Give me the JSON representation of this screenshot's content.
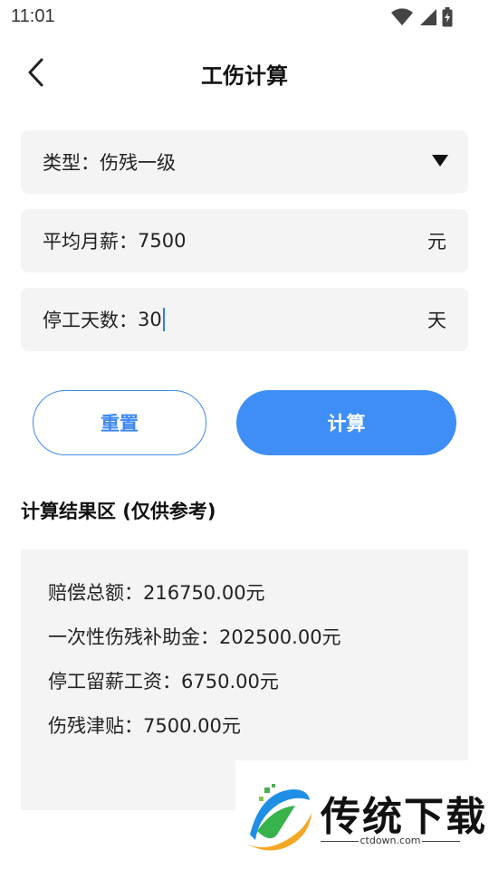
{
  "status": {
    "time": "11:01"
  },
  "header": {
    "title": "工伤计算"
  },
  "form": {
    "type_label": "类型：",
    "type_value": "伤残一级",
    "salary_label": "平均月薪：",
    "salary_value": "7500",
    "salary_unit": "元",
    "days_label": "停工天数：",
    "days_value": "30",
    "days_unit": "天"
  },
  "buttons": {
    "reset": "重置",
    "calculate": "计算"
  },
  "results": {
    "title": "计算结果区 (仅供参考)",
    "lines": [
      "赔偿总额：216750.00元",
      "一次性伤残补助金：202500.00元",
      "停工留薪工资：6750.00元",
      "伤残津贴：7500.00元"
    ]
  },
  "watermark": {
    "text": "传统下载",
    "url": "ctdown.com"
  },
  "colors": {
    "accent": "#3f8ef8",
    "field_bg": "#f4f4f4"
  },
  "icons": [
    "wifi-icon",
    "signal-icon",
    "battery-icon",
    "back-arrow-icon",
    "dropdown-arrow-icon",
    "logo-icon"
  ]
}
